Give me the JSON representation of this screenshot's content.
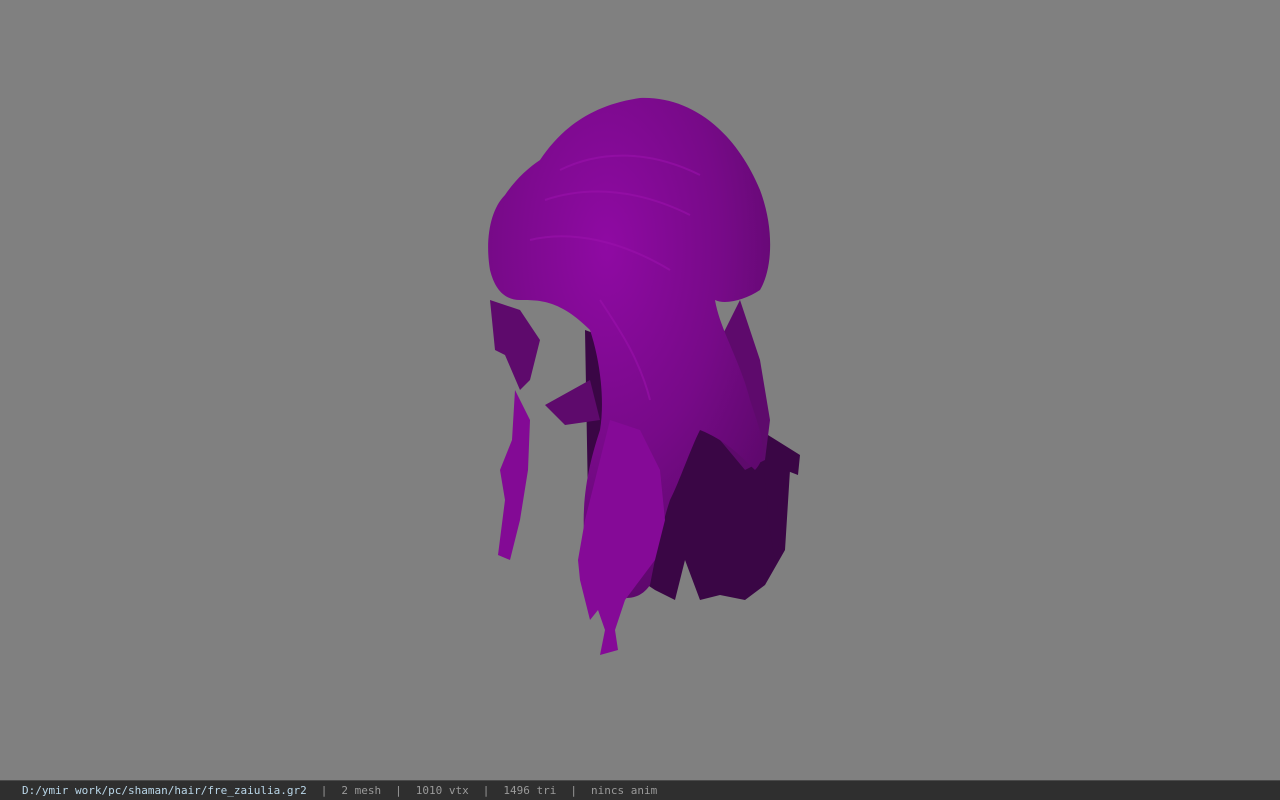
{
  "viewport": {
    "background_color": "#808080",
    "model": {
      "name": "hair-mesh",
      "color_light": "#8e0a9e",
      "color_mid": "#6b0a78",
      "color_dark": "#3a0645"
    }
  },
  "status_bar": {
    "path": "D:/ymir work/pc/shaman/hair/fre_zaiulia.gr2",
    "sep": "|",
    "mesh": "2 mesh",
    "vtx": "1010 vtx",
    "tri": "1496 tri",
    "anim": "nincs anim"
  }
}
